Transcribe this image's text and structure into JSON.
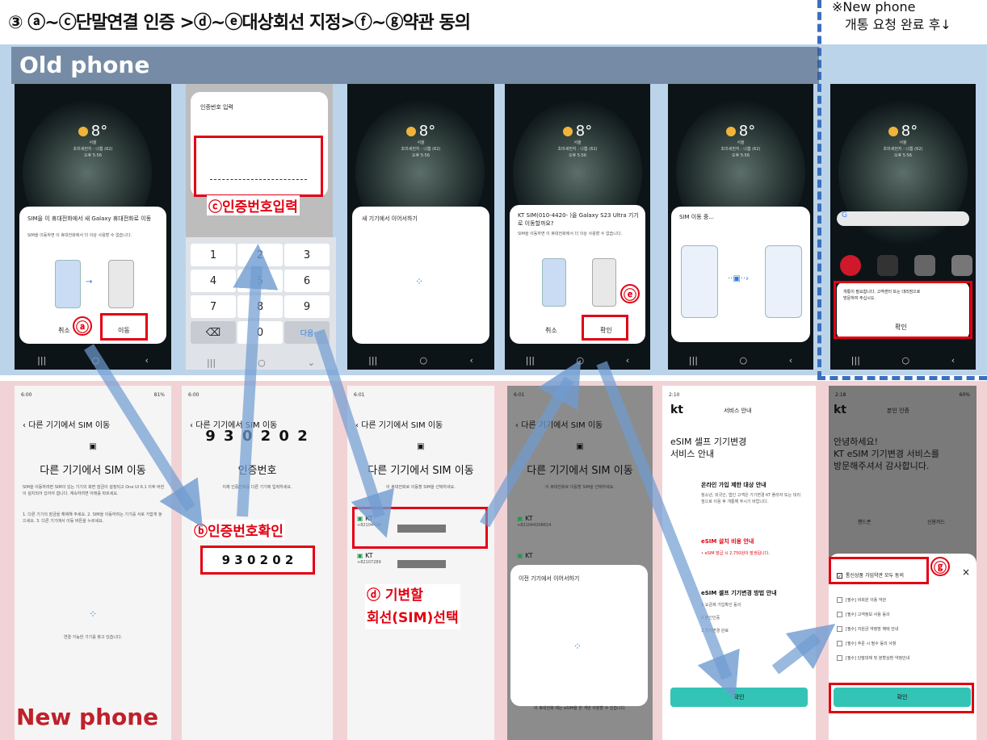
{
  "title": "③ ⓐ~ⓒ단말연결 인증 >ⓓ~ⓔ대상회선 지정>ⓕ~ⓖ약관 동의",
  "note_line1": "※New phone",
  "note_line2": "개통 요청 완료 후↓",
  "old_phone_label": "Old phone",
  "new_phone_label": "New phone",
  "weather": {
    "temp": "8°",
    "city": "서울",
    "detail": "초미세먼지 : 나쁨 (62)",
    "time": "오후 5:56"
  },
  "o1": {
    "text": "SIM을 이 휴대전화에서 새 Galaxy 휴대전화로 이동",
    "sub": "SIM을 이동하면 이 휴대전화에서 더 이상 사용할 수 없습니다.",
    "cancel": "취소",
    "move": "이동",
    "mark": "ⓐ"
  },
  "o2": {
    "title": "인증번호 입력",
    "annot": "ⓒ인증번호입력",
    "keys": [
      "1",
      "2",
      "3",
      "4",
      "5",
      "6",
      "7",
      "8",
      "9",
      "⌫",
      "0",
      "다음"
    ]
  },
  "o3": {
    "text": "새 기기에서 이어서하기"
  },
  "o4": {
    "text": "KT SIM(010-4420-   )을 Galaxy S23 Ultra 기기로 이동할까요?",
    "sub": "SIM을 이동하면 이 휴대전화에서 더 이상 사용할 수 없습니다.",
    "cancel": "취소",
    "ok": "확인",
    "mark": "ⓔ"
  },
  "o5": {
    "text": "SIM 이동 중..."
  },
  "o6": {
    "text": "개통이 필요합니다. 고객센터 또는 대리점으로 방문하여 주십시오.",
    "ok": "확인"
  },
  "n1": {
    "status": "6:00",
    "battery": "81%",
    "header": "다른 기기에서 SIM 이동",
    "big": "다른 기기에서 SIM 이동",
    "body": "SIM을 이동하려면 SIM이 있는 기기의 화면 잠금이 설정되고 One UI 6.1 이후 버전이 설치되어 있어야 합니다. 계속하려면 아래를 따르세요.",
    "steps": "1. 다른 기기의 잠금을 해제해 주세요. 2. SIM을 이동하려는 기기를 서로 가깝게 놓으세요. 3. 다른 기기에서 이동 버튼을 누르세요.",
    "searching": "연결 가능한 기기를 찾고 있습니다."
  },
  "n2": {
    "status": "6:00",
    "header": "다른 기기에서 SIM 이동",
    "code": "9 3 0 2 0 2",
    "label": "인증번호",
    "sub": "이제 인증번호를 다른 기기에 입력하세요.",
    "annot": "ⓑ인증번호확인",
    "boxcode": "9 3 0 2 0 2"
  },
  "n3": {
    "status": "6:01",
    "header": "다른 기기에서 SIM 이동",
    "big": "다른 기기에서 SIM 이동",
    "sub": "이 휴대전화로 이동할 SIM을 선택하세요.",
    "kt1": "KT",
    "kt1n": "+82104420",
    "kt2": "KT",
    "kt2n": "+82107289",
    "annot1": "ⓓ 기변할",
    "annot2": "회선(SIM)선택"
  },
  "n4": {
    "status": "6:01",
    "header": "다른 기기에서 SIM 이동",
    "big": "다른 기기에서 SIM 이동",
    "sub": "이 휴대전화로 이동할 SIM을 선택하세요.",
    "kt1": "KT",
    "kt1n": "+821044208614",
    "kt2": "KT",
    "sheet": "이전 기기에서 이어서하기",
    "foot": "이 휴대전화 에는 eSIM을 한 개만 저장할 수 있습니다."
  },
  "n5": {
    "status": "2:10",
    "logo": "kt",
    "hdr": "서비스 안내",
    "t1": "eSIM 셀프 기기변경",
    "t2": "서비스 안내",
    "s1": "온라인 가입 제한 대상 안내",
    "s1b": "청소년, 외국인, 법인 고객은 기기변경 KT 플라자 또는 대리점으로 이용 후 개통해 주시기 바랍니다.",
    "s2": "eSIM 설치 비용 안내",
    "s2b": "• eSIM 발급 시 2,750원이 발생됩니다.",
    "s3": "eSIM 셀프 기기변경 방법 안내",
    "steps": [
      "1 요금제 가입확인 동의",
      "2 본인인증",
      "3 기기변경 완료"
    ],
    "btn": "확인"
  },
  "n6": {
    "status": "2:18",
    "battery": "60%",
    "logo": "kt",
    "hdr": "본인 인증",
    "greet1": "안녕하세요!",
    "greet2": "KT eSIM 기기변경 서비스를",
    "greet3": "방문해주셔서 감사합니다.",
    "tab1": "핸드폰",
    "tab2": "신용카드",
    "agree_all": "통신상품 가입약관 모두 동의",
    "terms": [
      "[필수] 비회원 이용 약관",
      "[필수] 고객정보 사용 동의",
      "[필수] 지원금 약정방 혜택 안내",
      "[필수] 주문 시 필수 동의 사항",
      "[필수] 단말대체 및 분할상환 약정안내"
    ],
    "btn": "확인",
    "mark": "ⓖ"
  },
  "colors": {
    "red": "#e30012",
    "teal": "#34c4b5",
    "arrow": "#6f9bd1",
    "top_band": "#bcd4ea",
    "bottom_band": "#f2d3d5"
  }
}
